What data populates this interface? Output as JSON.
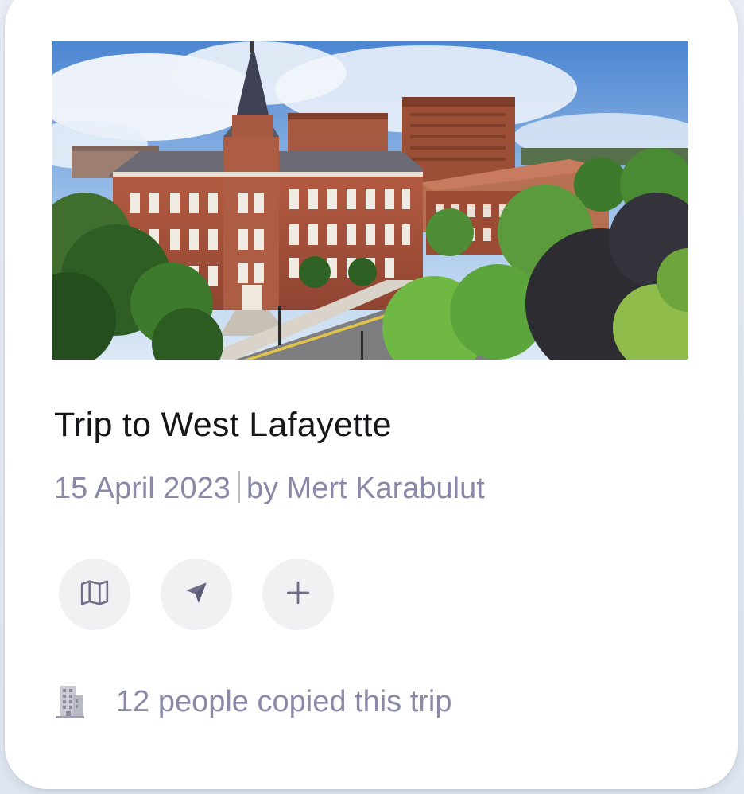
{
  "card": {
    "image_alt": "Campus building with brick facade and trees",
    "title": "Trip to West Lafayette",
    "date": "15  April 2023",
    "author": "by Mert Karabulut",
    "actions": [
      {
        "icon": "map-icon"
      },
      {
        "icon": "send-icon"
      },
      {
        "icon": "plus-icon"
      }
    ],
    "footer_icon": "building-icon",
    "footer_text": "12 people copied this trip"
  },
  "colors": {
    "card_background": "#ffffff",
    "title": "#15151a",
    "muted_text": "#8a89a8",
    "action_button_bg": "#f1f1f3",
    "icon_color": "#6f6e88"
  }
}
